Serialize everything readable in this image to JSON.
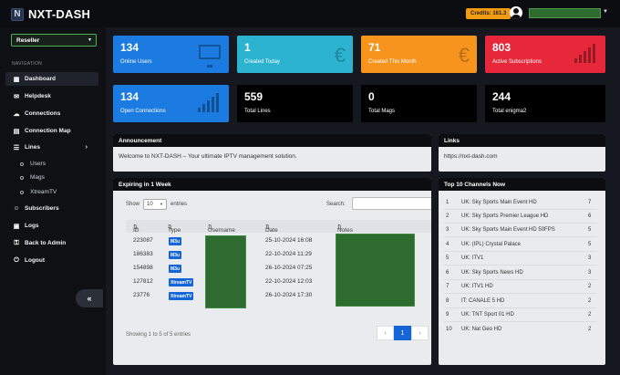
{
  "topbar": {
    "brand": "NXT-DASH",
    "credits": "Credits: 161.3"
  },
  "sidebar": {
    "role": "Reseller",
    "nav_title": "NAVIGATION",
    "items": [
      {
        "label": "Dashboard",
        "icon": "dashboard-icon"
      },
      {
        "label": "Helpdesk",
        "icon": "chat-icon"
      },
      {
        "label": "Connections",
        "icon": "connections-icon"
      },
      {
        "label": "Connection Map",
        "icon": "map-icon"
      },
      {
        "label": "Lines",
        "icon": "list-icon"
      },
      {
        "label": "Subscribers",
        "icon": "users-icon"
      },
      {
        "label": "Logs",
        "icon": "logs-icon"
      },
      {
        "label": "Back to Admin",
        "icon": "key-icon"
      },
      {
        "label": "Logout",
        "icon": "power-icon"
      }
    ],
    "sub_items": [
      "Users",
      "Mags",
      "XtreamTV"
    ],
    "collapse": "«"
  },
  "stats": [
    {
      "num": "134",
      "label": "Online Users",
      "color": "#1b7be0"
    },
    {
      "num": "1",
      "label": "Created Today",
      "color": "#2bb3cf"
    },
    {
      "num": "71",
      "label": "Created This Month",
      "color": "#f7941d"
    },
    {
      "num": "803",
      "label": "Active Subscriptions",
      "color": "#e6283a"
    },
    {
      "num": "134",
      "label": "Open Connections",
      "color": "#1b7be0"
    },
    {
      "num": "559",
      "label": "Total Lines",
      "color": "#000000"
    },
    {
      "num": "0",
      "label": "Total Mags",
      "color": "#000000"
    },
    {
      "num": "244",
      "label": "Total enigma2",
      "color": "#000000"
    }
  ],
  "announcement": {
    "title": "Announcement",
    "text": "Welcome to NXT-DASH – Your ultimate IPTV management solution."
  },
  "links": {
    "title": "Links",
    "text": "https://nxt-dash.com"
  },
  "expiring": {
    "title": "Expiring in 1 Week",
    "show": "Show",
    "entries_value": "10",
    "entries": "entries",
    "search": "Search:",
    "headers": [
      "ID",
      "Type",
      "Username",
      "Date",
      "Notes"
    ],
    "rows": [
      {
        "id": "223087",
        "type": "M3u",
        "date": "25-10-2024 16:08"
      },
      {
        "id": "186383",
        "type": "M3u",
        "date": "22-10-2024 11:29"
      },
      {
        "id": "154898",
        "type": "M3u",
        "date": "26-10-2024 07:25"
      },
      {
        "id": "127812",
        "type": "XtreamTV",
        "date": "22-10-2024 12:03"
      },
      {
        "id": "23776",
        "type": "XtreamTV",
        "date": "26-10-2024 17:30"
      }
    ],
    "info": "Showing 1 to 5 of 5 entries",
    "pager": [
      "‹",
      "1",
      "›"
    ]
  },
  "top_channels": {
    "title": "Top 10 Channels Now",
    "rows": [
      {
        "rank": "1",
        "name": "UK: Sky Sports Main Event HD",
        "count": "7"
      },
      {
        "rank": "2",
        "name": "UK: Sky Sports Premier League HD",
        "count": "6"
      },
      {
        "rank": "3",
        "name": "UK: Sky Sports Main Event HD 50FPS",
        "count": "5"
      },
      {
        "rank": "4",
        "name": "UK: (IPL) Crystal Palace",
        "count": "5"
      },
      {
        "rank": "5",
        "name": "UK: ITV1",
        "count": "3"
      },
      {
        "rank": "6",
        "name": "UK: Sky Sports News HD",
        "count": "3"
      },
      {
        "rank": "7",
        "name": "UK: ITV1 HD",
        "count": "2"
      },
      {
        "rank": "8",
        "name": "IT: CANALE 5 HD",
        "count": "2"
      },
      {
        "rank": "9",
        "name": "UK: TNT Sport 01 HD",
        "count": "2"
      },
      {
        "rank": "10",
        "name": "UK: Nat Geo HD",
        "count": "2"
      }
    ]
  }
}
